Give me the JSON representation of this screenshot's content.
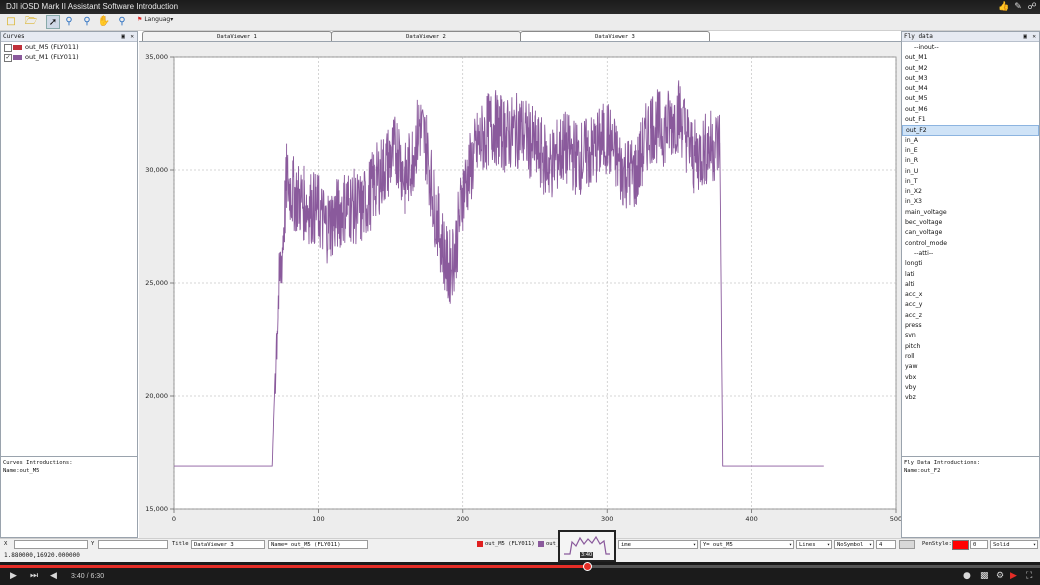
{
  "window": {
    "title": "DJI iOSD Mark II Assistant Software Introduction",
    "title_icons": [
      "thumbs-up-icon",
      "comment-icon",
      "share-icon"
    ]
  },
  "toolbar": {
    "icons": [
      "new-file-icon",
      "open-folder-icon",
      "pointer-icon",
      "zoom-in-icon",
      "zoom-out-icon",
      "pan-hand-icon",
      "zoom-fit-icon"
    ],
    "language_label": "Languag▾"
  },
  "curves_panel": {
    "title": "Curves",
    "items": [
      {
        "label": "out_M5 (FLY011)",
        "checked": false,
        "color": "#c0303a"
      },
      {
        "label": "out_M1 (FLY011)",
        "checked": true,
        "color": "#8a5a9c"
      }
    ],
    "intro_title": "Curves Introductions:",
    "intro_name": "Name:out_M5"
  },
  "tabs": [
    "DataViewer 1",
    "DataViewer 2",
    "DataViewer 3"
  ],
  "active_tab": 2,
  "fly_panel": {
    "title": "Fly data",
    "items": [
      "--inout--",
      "out_M1",
      "out_M2",
      "out_M3",
      "out_M4",
      "out_M5",
      "out_M6",
      "out_F1",
      "out_F2",
      "in_A",
      "in_E",
      "in_R",
      "in_U",
      "in_T",
      "in_X2",
      "in_X3",
      "main_voltage",
      "bec_voltage",
      "can_voltage",
      "control_mode",
      "--atti--",
      "longti",
      "lati",
      "alti",
      "acc_x",
      "acc_y",
      "acc_z",
      "press",
      "svn",
      "pitch",
      "roll",
      "yaw",
      "vbx",
      "vby",
      "vbz"
    ],
    "selected": "out_F2",
    "intro_title": "Fly Data Introductions:",
    "intro_name": "Name:out_F2"
  },
  "chart_data": {
    "type": "line",
    "xlim": [
      0,
      500
    ],
    "ylim": [
      15000,
      35000
    ],
    "x_ticks": [
      0,
      100,
      200,
      300,
      400,
      500
    ],
    "x_tick_labels": [
      "0",
      "100",
      "200",
      "300",
      "400",
      "500"
    ],
    "y_ticks": [
      15000,
      20000,
      25000,
      30000,
      35000
    ],
    "y_tick_labels": [
      "15,000",
      "20,000",
      "25,000",
      "30,000",
      "35,000"
    ],
    "grid": true,
    "legend_position": "bottom-center",
    "series": [
      {
        "name": "out_M5 (FLY011)",
        "color": "#e02020",
        "x": [
          0,
          68,
          70,
          72,
          75,
          78,
          82,
          90,
          100,
          105,
          110,
          120,
          130,
          140,
          150,
          155,
          160,
          165,
          170,
          175,
          180,
          185,
          190,
          195,
          200,
          210,
          220,
          230,
          240,
          250,
          260,
          270,
          280,
          290,
          300,
          310,
          320,
          330,
          340,
          350,
          360,
          370,
          378,
          380,
          383,
          400,
          450
        ],
        "y": [
          16900,
          16900,
          21000,
          24000,
          26500,
          29500,
          29000,
          28500,
          28200,
          27500,
          27800,
          28500,
          28200,
          29500,
          30500,
          31000,
          29500,
          30500,
          32000,
          31000,
          28500,
          27000,
          25500,
          26500,
          29000,
          31000,
          32000,
          31500,
          31800,
          31000,
          30200,
          31000,
          30500,
          30800,
          31500,
          30000,
          29800,
          32000,
          31800,
          32500,
          30500,
          31000,
          31200,
          16900,
          16900,
          16900,
          16900
        ]
      },
      {
        "name": "out_M1 (FLY011)",
        "color": "#8a5a9c",
        "x": [
          0,
          68,
          70,
          72,
          75,
          78,
          82,
          90,
          100,
          105,
          110,
          120,
          130,
          140,
          150,
          155,
          160,
          165,
          170,
          175,
          180,
          185,
          190,
          195,
          200,
          210,
          220,
          230,
          240,
          250,
          260,
          270,
          280,
          290,
          300,
          310,
          320,
          330,
          340,
          350,
          360,
          370,
          378,
          380,
          383,
          400,
          450
        ],
        "y": [
          16900,
          16900,
          21000,
          24000,
          26500,
          29500,
          29000,
          28500,
          28200,
          27500,
          27800,
          28500,
          28200,
          29500,
          30500,
          31000,
          29500,
          30500,
          32000,
          31000,
          28500,
          27000,
          25500,
          26500,
          29000,
          31000,
          32000,
          31500,
          31800,
          31000,
          30200,
          31000,
          30500,
          30800,
          31500,
          30000,
          29800,
          32000,
          31800,
          32500,
          30500,
          31000,
          31200,
          16900,
          16900,
          16900,
          16900
        ]
      }
    ]
  },
  "bottom_bar": {
    "x_label": "X",
    "y_label": "Y",
    "title_label": "Title",
    "title_value": "DataViewer 3",
    "name_value": "Name= out_M5 (FLY011)",
    "x_select": "ime",
    "y_select": "Y= out_M5",
    "line_select": "Lines",
    "symbol_select": "NoSymbol",
    "width_value": "4",
    "penstyle_label": "PenStyle:",
    "pen_color": "#ff0000",
    "alpha_value": "0",
    "style_select": "Solid"
  },
  "status": {
    "coords": "1.880000,16920.000000"
  },
  "video": {
    "time": "3:40 / 6:30",
    "thumb_time": "3:40",
    "progress": 0.564,
    "icons": [
      "play-icon",
      "next-icon",
      "volume-icon",
      "annotations-icon",
      "captions-icon",
      "settings-icon",
      "youtube-icon",
      "fullscreen-icon"
    ]
  }
}
